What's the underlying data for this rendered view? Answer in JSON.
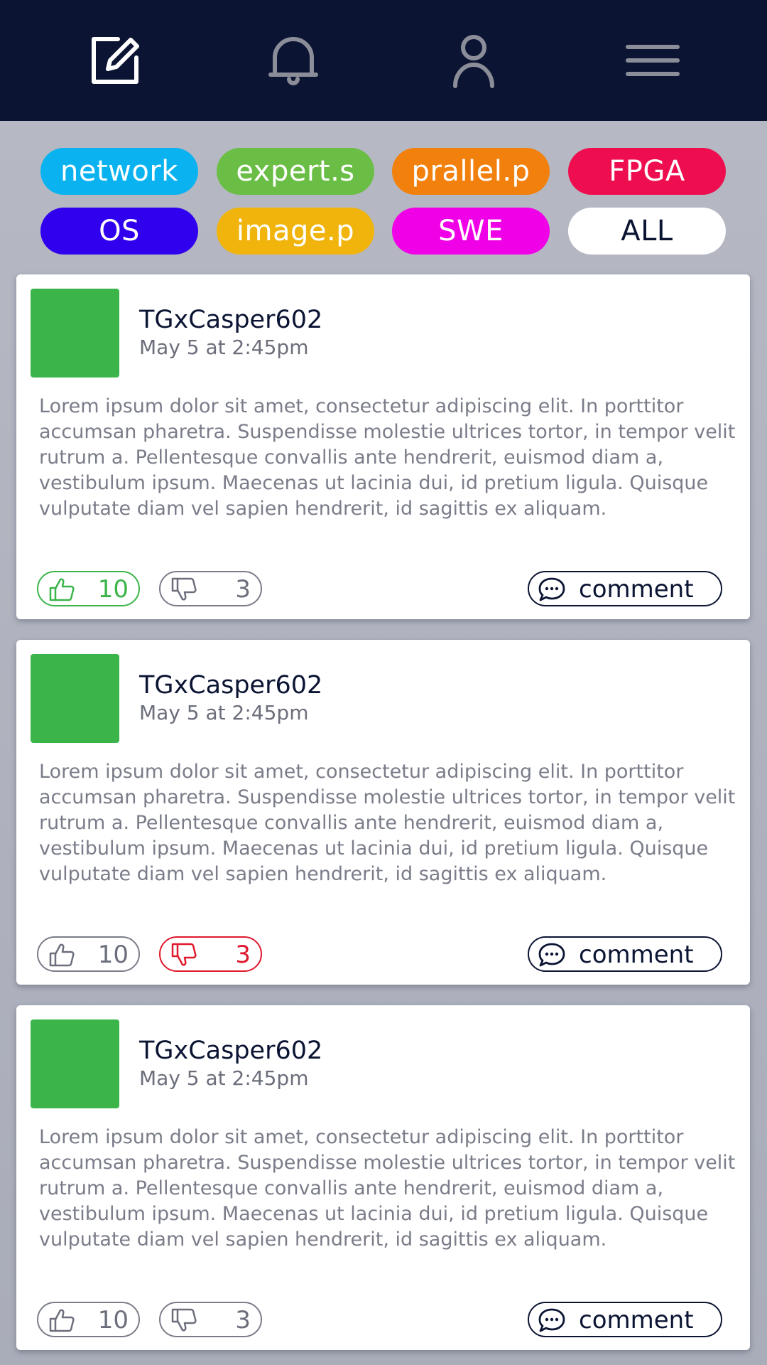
{
  "nav": {
    "items": [
      {
        "icon": "edit-icon",
        "active": true
      },
      {
        "icon": "bell-icon",
        "active": false
      },
      {
        "icon": "user-icon",
        "active": false
      },
      {
        "icon": "menu-icon",
        "active": false
      }
    ],
    "colors": {
      "background": "#0b1433",
      "active": "#ffffff",
      "inactive": "#8b8e99"
    }
  },
  "tags": [
    {
      "label": "network",
      "color": "#0ab3ef",
      "text_color": "#ffffff"
    },
    {
      "label": "expert.s",
      "color": "#6abe45",
      "text_color": "#ffffff"
    },
    {
      "label": "prallel.p",
      "color": "#f2800c",
      "text_color": "#ffffff"
    },
    {
      "label": "FPGA",
      "color": "#ee0e4f",
      "text_color": "#ffffff"
    },
    {
      "label": "OS",
      "color": "#3000ee",
      "text_color": "#ffffff"
    },
    {
      "label": "image.p",
      "color": "#f0b40c",
      "text_color": "#ffffff"
    },
    {
      "label": "SWE",
      "color": "#f000e6",
      "text_color": "#ffffff"
    },
    {
      "label": "ALL",
      "color": "#ffffff",
      "text_color": "#0b1433"
    }
  ],
  "posts": [
    {
      "username": "TGxCasper602",
      "timestamp": "May 5 at 2:45pm",
      "body": "Lorem ipsum dolor sit amet, consectetur adipiscing elit. In porttitor accumsan pharetra. Suspendisse molestie ultrices tortor, in tempor velit rutrum a. Pellentesque convallis ante hendrerit, euismod diam a, vestibulum ipsum. Maecenas ut lacinia dui, id pretium ligula. Quisque vulputate diam vel sapien hendrerit, id sagittis ex aliquam.",
      "likes": "10",
      "dislikes": "3",
      "liked": true,
      "disliked": false,
      "comment_label": "comment"
    },
    {
      "username": "TGxCasper602",
      "timestamp": "May 5 at 2:45pm",
      "body": "Lorem ipsum dolor sit amet, consectetur adipiscing elit. In porttitor accumsan pharetra. Suspendisse molestie ultrices tortor, in tempor velit rutrum a. Pellentesque convallis ante hendrerit, euismod diam a, vestibulum ipsum. Maecenas ut lacinia dui, id pretium ligula. Quisque vulputate diam vel sapien hendrerit, id sagittis ex aliquam.",
      "likes": "10",
      "dislikes": "3",
      "liked": false,
      "disliked": true,
      "comment_label": "comment"
    },
    {
      "username": "TGxCasper602",
      "timestamp": "May 5 at 2:45pm",
      "body": "Lorem ipsum dolor sit amet, consectetur adipiscing elit. In porttitor accumsan pharetra. Suspendisse molestie ultrices tortor, in tempor velit rutrum a. Pellentesque convallis ante hendrerit, euismod diam a, vestibulum ipsum. Maecenas ut lacinia dui, id pretium ligula. Quisque vulputate diam vel sapien hendrerit, id sagittis ex aliquam.",
      "likes": "10",
      "dislikes": "3",
      "liked": false,
      "disliked": false,
      "comment_label": "comment"
    }
  ],
  "colors": {
    "avatar": "#3bb54a",
    "like_active": "#3bb54a",
    "dislike_active": "#e0182d",
    "neutral": "#7a7d89",
    "text_dark": "#0b1433"
  }
}
